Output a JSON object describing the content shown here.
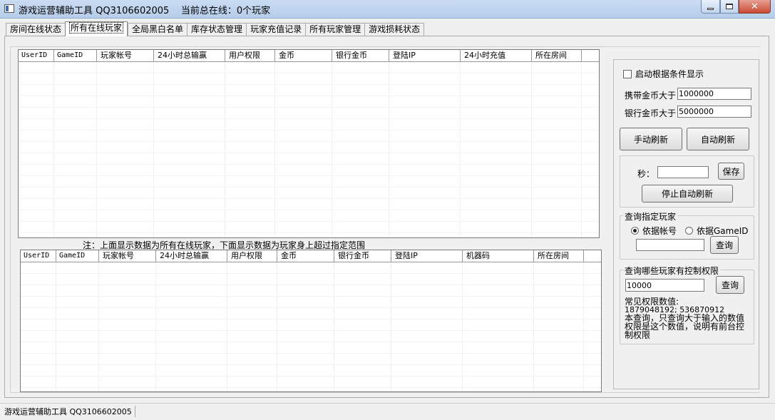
{
  "window": {
    "title": "游戏运营辅助工具 QQ3106602005    当前总在线：0个玩家"
  },
  "tabs": [
    {
      "label": "房间在线状态"
    },
    {
      "label": "所有在线玩家"
    },
    {
      "label": "全局黑白名单"
    },
    {
      "label": "库存状态管理"
    },
    {
      "label": "玩家充值记录"
    },
    {
      "label": "所有玩家管理"
    },
    {
      "label": "游戏损耗状态"
    }
  ],
  "top_grid": {
    "columns": [
      "UserID",
      "GameID",
      "玩家帐号",
      "24小时总输赢",
      "用户权限",
      "金币",
      "银行金币",
      "登陆IP",
      "24小时充值",
      "所在房间"
    ],
    "rows": []
  },
  "note": "注：上面显示数据为所有在线玩家，下面显示数据为玩家身上超过指定范围",
  "bottom_grid": {
    "columns": [
      "UserID",
      "GameID",
      "玩家帐号",
      "24小时总输赢",
      "用户权限",
      "金币",
      "银行金币",
      "登陆IP",
      "机器码",
      "所在房间"
    ],
    "rows": []
  },
  "filters": {
    "enable_label": "启动根据条件显示",
    "enabled": false,
    "carry_gold_label": "携带金币大于",
    "carry_gold_value": "1000000",
    "bank_gold_label": "银行金币大于",
    "bank_gold_value": "5000000",
    "manual_refresh": "手动刷新",
    "auto_refresh": "自动刷新"
  },
  "auto_refresh": {
    "seconds_label": "秒：",
    "seconds_value": "",
    "save": "保存",
    "stop": "停止自动刷新"
  },
  "query_player": {
    "title": "查询指定玩家",
    "radio_account": "依据帐号",
    "radio_gameid": "依据GameID",
    "selected": "account",
    "value": "",
    "button": "查询"
  },
  "query_control": {
    "title": "查询哪些玩家有控制权限",
    "value": "10000",
    "button": "查询",
    "common_label": "常见权限数值:",
    "common_values": "1879048192; 536870912",
    "description": "本查询，只查询大于输入的数值权限是这个数值，说明有前台控制权限"
  },
  "statusbar": {
    "text": "游戏运营辅助工具 QQ3106602005"
  }
}
